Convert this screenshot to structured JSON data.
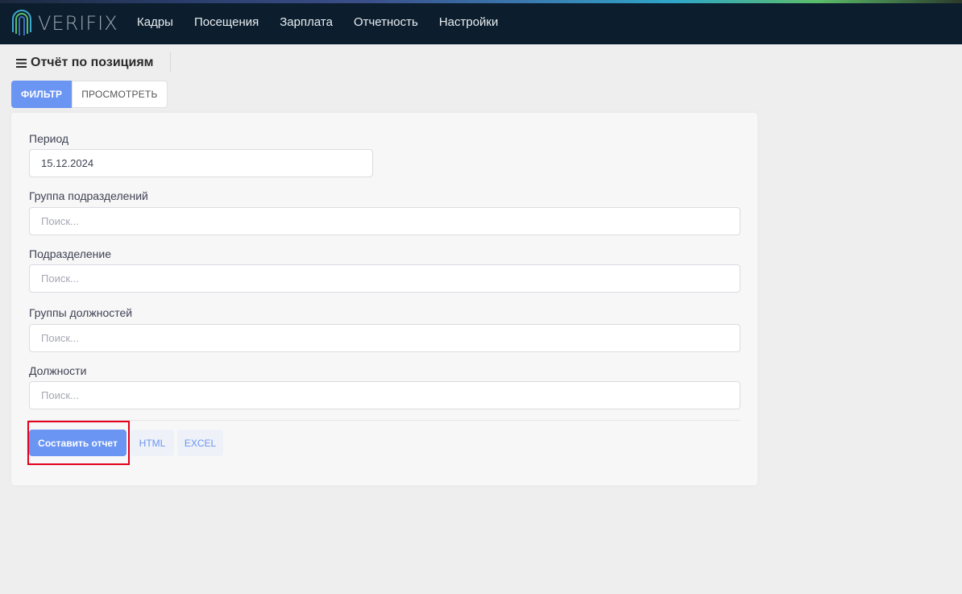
{
  "brand": {
    "name": "VERIFIX"
  },
  "nav": {
    "items": [
      {
        "label": "Кадры"
      },
      {
        "label": "Посещения"
      },
      {
        "label": "Зарплата"
      },
      {
        "label": "Отчетность"
      },
      {
        "label": "Настройки"
      }
    ]
  },
  "page": {
    "title": "Отчёт по позициям"
  },
  "tabs": [
    {
      "label": "ФИЛЬТР",
      "active": true
    },
    {
      "label": "ПРОСМОТРЕТЬ",
      "active": false
    }
  ],
  "form": {
    "period": {
      "label": "Период",
      "value": "15.12.2024"
    },
    "division_group": {
      "label": "Группа подразделений",
      "placeholder": "Поиск..."
    },
    "division": {
      "label": "Подразделение",
      "placeholder": "Поиск..."
    },
    "position_groups": {
      "label": "Группы должностей",
      "placeholder": "Поиск..."
    },
    "positions": {
      "label": "Должности",
      "placeholder": "Поиск..."
    }
  },
  "actions": {
    "build_report": "Составить отчет",
    "html": "HTML",
    "excel": "EXCEL"
  },
  "colors": {
    "navbar_bg": "#0c1e2e",
    "primary": "#6b95f3",
    "highlight": "#e3001b",
    "page_bg": "#eeeeee"
  }
}
